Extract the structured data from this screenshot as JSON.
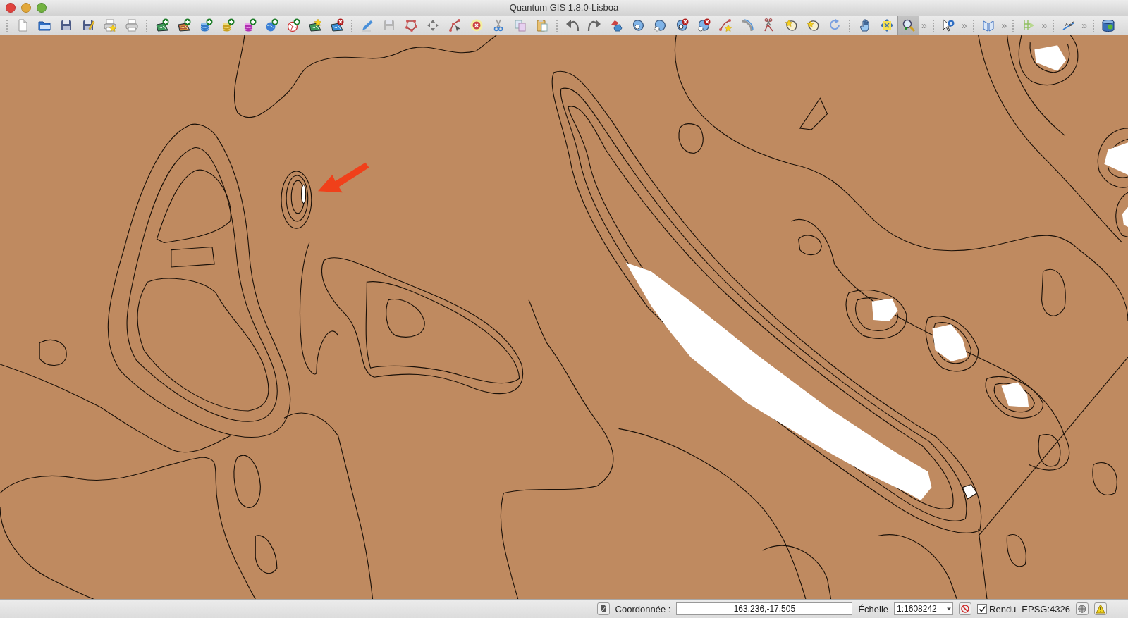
{
  "window": {
    "title": "Quantum GIS 1.8.0-Lisboa"
  },
  "toolbar": [
    {
      "kind": "grip"
    },
    {
      "kind": "new-document",
      "selected": false
    },
    {
      "kind": "open",
      "selected": false
    },
    {
      "kind": "save",
      "selected": false
    },
    {
      "kind": "save-as",
      "selected": false
    },
    {
      "kind": "print-composer",
      "selected": false
    },
    {
      "kind": "print",
      "selected": false
    },
    {
      "kind": "grip"
    },
    {
      "kind": "add-vector",
      "selected": false
    },
    {
      "kind": "add-raster",
      "selected": false
    },
    {
      "kind": "add-postgis",
      "selected": false
    },
    {
      "kind": "add-spatialite",
      "selected": false
    },
    {
      "kind": "add-mssql",
      "selected": false
    },
    {
      "kind": "add-wms",
      "selected": false
    },
    {
      "kind": "add-wfs",
      "selected": false
    },
    {
      "kind": "new-layer",
      "selected": false
    },
    {
      "kind": "remove-layer",
      "selected": false
    },
    {
      "kind": "grip"
    },
    {
      "kind": "toggle-edit",
      "selected": false
    },
    {
      "kind": "save-edits",
      "selected": false
    },
    {
      "kind": "add-feature",
      "selected": false
    },
    {
      "kind": "move-feature",
      "selected": false
    },
    {
      "kind": "node-tool",
      "selected": false
    },
    {
      "kind": "delete-selected",
      "selected": false
    },
    {
      "kind": "cut",
      "selected": false
    },
    {
      "kind": "copy",
      "selected": false
    },
    {
      "kind": "paste",
      "selected": false
    },
    {
      "kind": "grip"
    },
    {
      "kind": "undo",
      "selected": false
    },
    {
      "kind": "redo",
      "selected": false
    },
    {
      "kind": "simplify",
      "selected": false
    },
    {
      "kind": "add-ring",
      "selected": false
    },
    {
      "kind": "add-part",
      "selected": false
    },
    {
      "kind": "delete-ring",
      "selected": false
    },
    {
      "kind": "delete-part",
      "selected": false
    },
    {
      "kind": "reshape",
      "selected": false
    },
    {
      "kind": "offset-curve",
      "selected": false
    },
    {
      "kind": "split",
      "selected": false
    },
    {
      "kind": "merge",
      "selected": false
    },
    {
      "kind": "merge-attributes",
      "selected": false
    },
    {
      "kind": "rotate",
      "selected": false
    },
    {
      "kind": "grip"
    },
    {
      "kind": "pan",
      "selected": false
    },
    {
      "kind": "zoom-full",
      "selected": false
    },
    {
      "kind": "zoom-in",
      "selected": true
    },
    {
      "kind": "overflow",
      "label": "»"
    },
    {
      "kind": "grip"
    },
    {
      "kind": "identify",
      "selected": false
    },
    {
      "kind": "overflow",
      "label": "»"
    },
    {
      "kind": "grip"
    },
    {
      "kind": "bookmark",
      "selected": false
    },
    {
      "kind": "overflow",
      "label": "»"
    },
    {
      "kind": "grip"
    },
    {
      "kind": "raster-tool",
      "selected": false
    },
    {
      "kind": "overflow",
      "label": "»"
    },
    {
      "kind": "grip"
    },
    {
      "kind": "labeling",
      "selected": false
    },
    {
      "kind": "overflow",
      "label": "»"
    },
    {
      "kind": "grip"
    },
    {
      "kind": "database",
      "selected": false
    }
  ],
  "status_bar": {
    "coordinate_label": "Coordonnée :",
    "coordinate_value": "163.236,-17.505",
    "scale_label": "Échelle",
    "scale_value": "1:1608242",
    "render": {
      "label": "Rendu",
      "checked": true
    },
    "crs": "EPSG:4326"
  }
}
